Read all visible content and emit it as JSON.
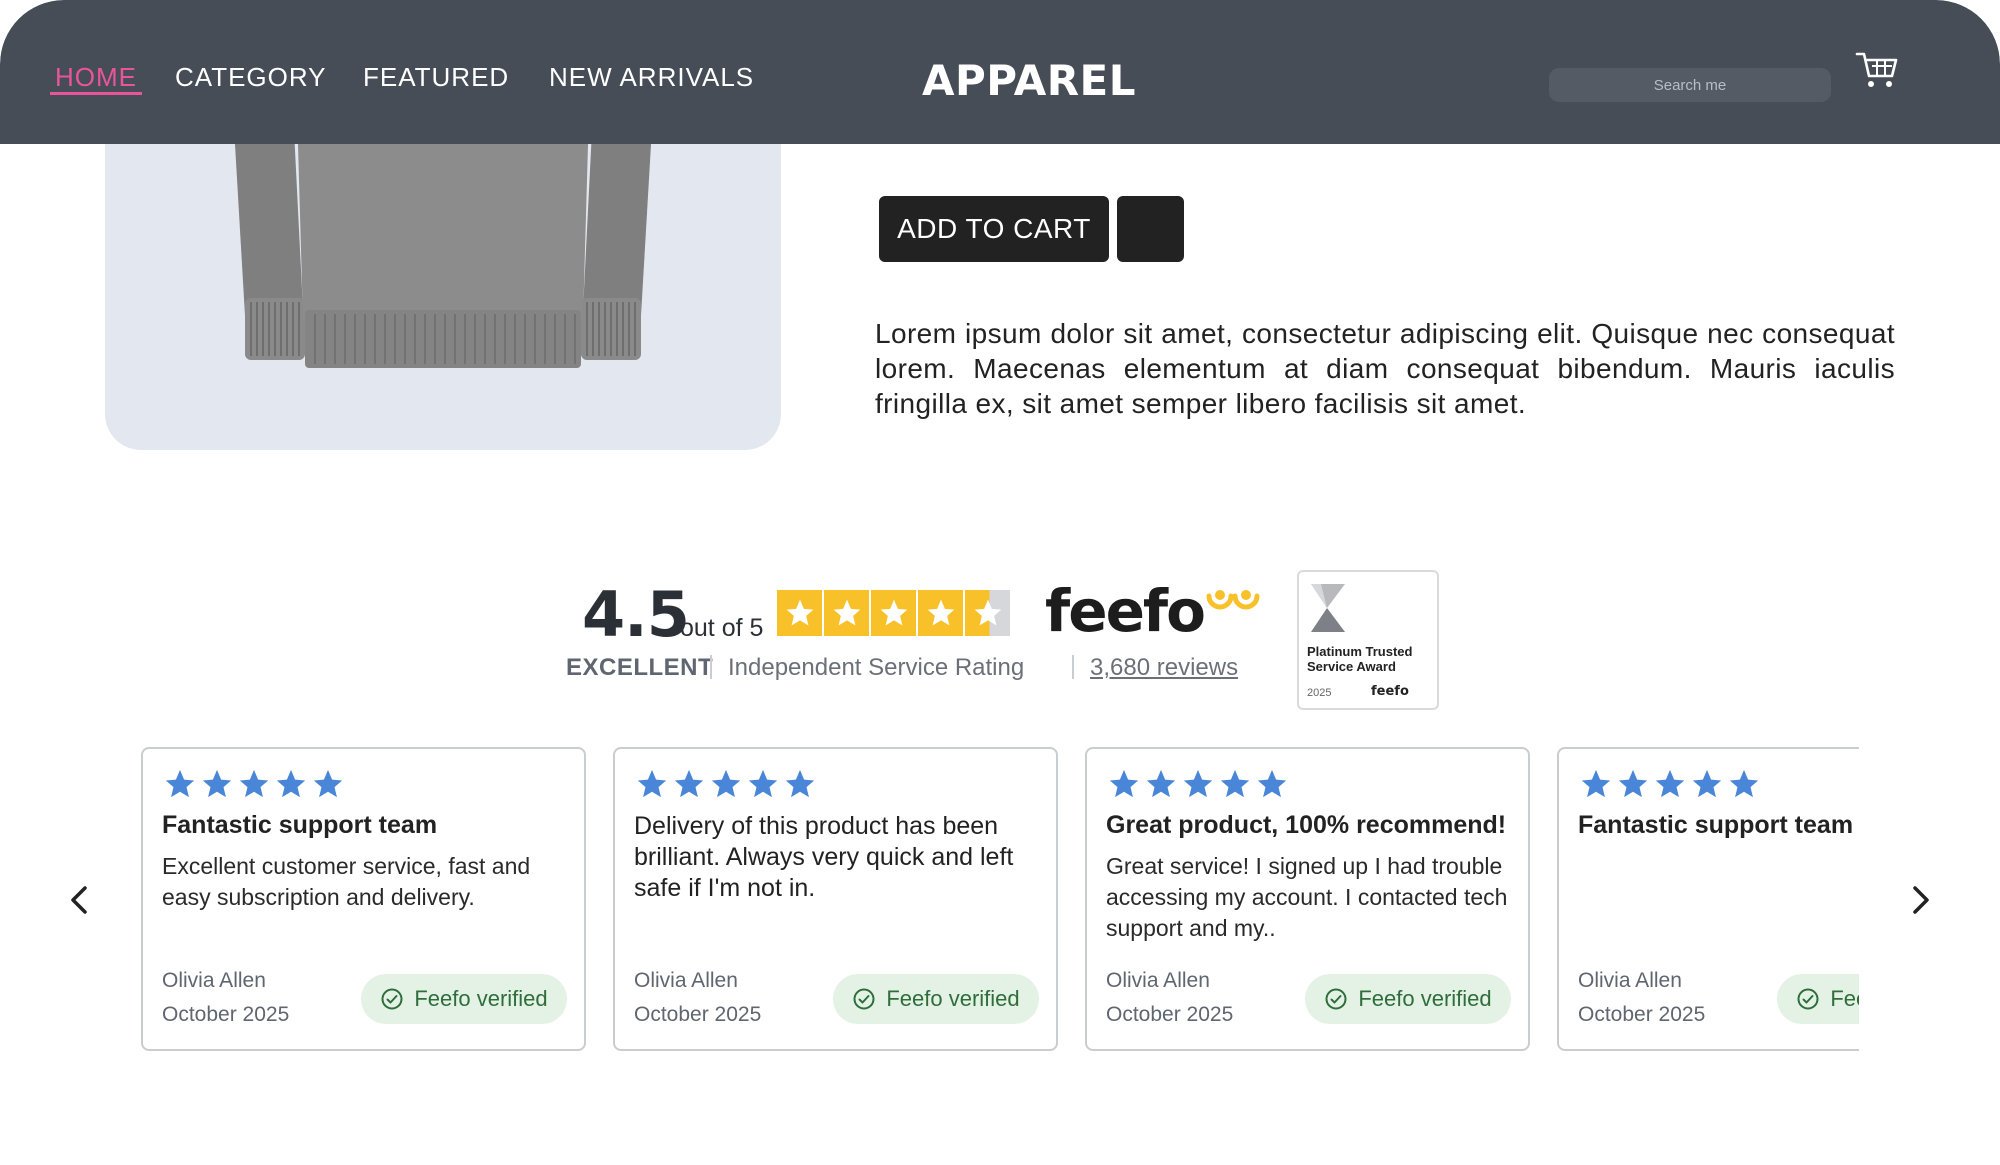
{
  "header": {
    "nav": [
      {
        "label": "HOME",
        "active": true
      },
      {
        "label": "CATEGORY",
        "active": false
      },
      {
        "label": "FEATURED",
        "active": false
      },
      {
        "label": "NEW ARRIVALS",
        "active": false
      }
    ],
    "brand": "APPAREL",
    "search_placeholder": "Search me",
    "cart_icon": "shopping-cart-icon"
  },
  "product": {
    "image_icon": "grey-sweater-image",
    "add_to_cart_label": "ADD TO CART",
    "description": "Lorem ipsum dolor sit amet, consectetur adipiscing elit. Quisque nec consequat lorem. Maecenas elementum at diam consequat bibendum. Mauris iaculis fringilla ex, sit amet semper libero facilisis sit amet."
  },
  "rating": {
    "score": "4.5",
    "out_of": "out of 5",
    "stars_value": 4.5,
    "stars_max": 5,
    "provider": "feefo",
    "label": "EXCELLENT",
    "description": "Independent Service Rating",
    "reviews_link": "3,680 reviews",
    "award": {
      "title": "Platinum Trusted Service Award",
      "year": "2025",
      "brand": "feefo"
    }
  },
  "reviews": [
    {
      "stars": 5,
      "title": "Fantastic support team",
      "body": "Excellent customer service, fast and easy subscription and delivery.",
      "author": "Olivia Allen",
      "date": "October 2025",
      "badge": "Feefo verified"
    },
    {
      "stars": 5,
      "title": "",
      "body_as_title": "Delivery of this product has been brilliant. Always very quick and left safe if I'm not in.",
      "author": "Olivia Allen",
      "date": "October 2025",
      "badge": "Feefo verified"
    },
    {
      "stars": 5,
      "title": "Great product, 100% recommend!",
      "body": "Great service!  I signed up I had trouble accessing my account. I contacted tech support and my..",
      "author": "Olivia Allen",
      "date": "October 2025",
      "badge": "Feefo verified"
    },
    {
      "stars": 5,
      "title": "Fantastic support team",
      "body": "",
      "author": "Olivia Allen",
      "date": "October 2025",
      "badge": "Feefo verified"
    }
  ],
  "colors": {
    "header_bg": "#474d57",
    "nav_active": "#e8559a",
    "rating_star": "#f8c12a",
    "review_star": "#4a86d8",
    "verified_bg": "#e4f2e6"
  },
  "icons": {
    "prev": "chevron-left-icon",
    "next": "chevron-right-icon",
    "verified": "check-circle-icon"
  }
}
